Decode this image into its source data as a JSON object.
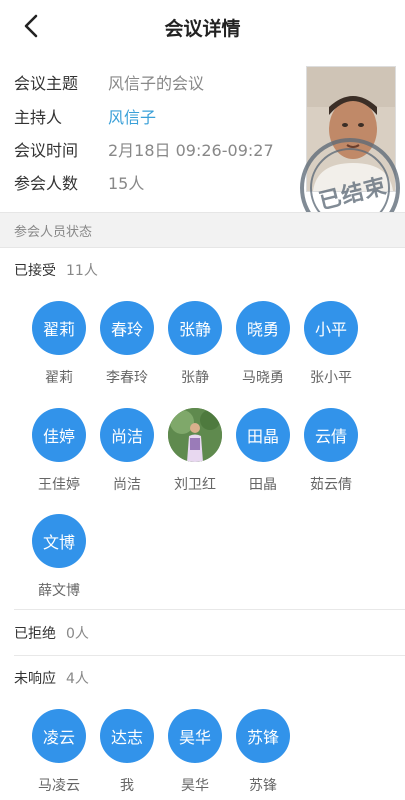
{
  "header": {
    "title": "会议详情"
  },
  "info": {
    "topic_label": "会议主题",
    "topic_value": "风信子的会议",
    "host_label": "主持人",
    "host_value": "风信子",
    "time_label": "会议时间",
    "time_value": "2月18日 09:26-09:27",
    "count_label": "参会人数",
    "count_value": "15人",
    "stamp_text": "已结束"
  },
  "section": {
    "title": "参会人员状态"
  },
  "accepted": {
    "label": "已接受",
    "count": "11人",
    "people": [
      {
        "avatar": "翟莉",
        "name": "翟莉"
      },
      {
        "avatar": "春玲",
        "name": "李春玲"
      },
      {
        "avatar": "张静",
        "name": "张静"
      },
      {
        "avatar": "晓勇",
        "name": "马晓勇"
      },
      {
        "avatar": "小平",
        "name": "张小平"
      },
      {
        "avatar": "佳婷",
        "name": "王佳婷"
      },
      {
        "avatar": "尚洁",
        "name": "尚洁"
      },
      {
        "avatar": "",
        "name": "刘卫红"
      },
      {
        "avatar": "田晶",
        "name": "田晶"
      },
      {
        "avatar": "云倩",
        "name": "茹云倩"
      },
      {
        "avatar": "文博",
        "name": "薛文博"
      }
    ]
  },
  "rejected": {
    "label": "已拒绝",
    "count": "0人"
  },
  "pending": {
    "label": "未响应",
    "count": "4人",
    "people": [
      {
        "avatar": "凌云",
        "name": "马凌云"
      },
      {
        "avatar": "达志",
        "name": "我"
      },
      {
        "avatar": "昊华",
        "name": "昊华"
      },
      {
        "avatar": "苏锋",
        "name": "苏锋"
      }
    ]
  },
  "colors": {
    "avatar_bg": "#3293ea",
    "link": "#3aa0d8"
  }
}
